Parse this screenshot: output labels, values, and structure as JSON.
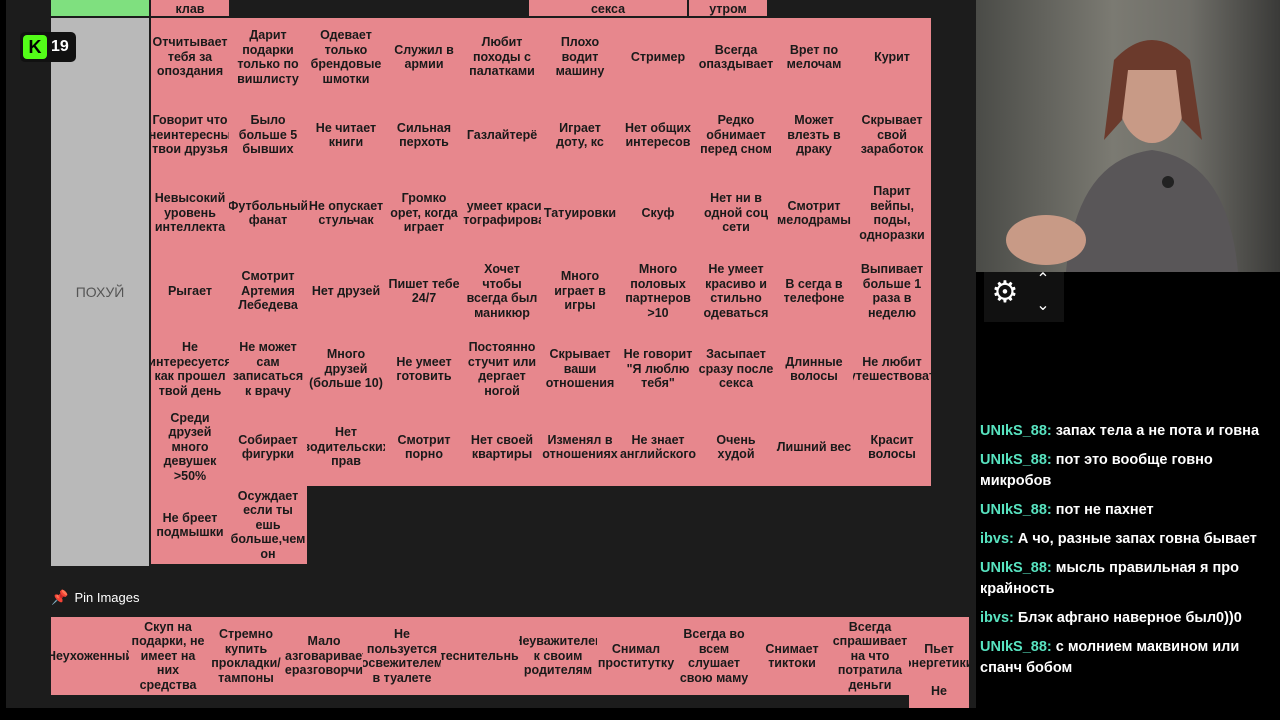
{
  "badge": {
    "count": "19"
  },
  "tier": {
    "top_row_partial": [
      "клав",
      "секса",
      "утром"
    ],
    "label": "ПОХУЙ",
    "rows": [
      [
        "Отчитывает тебя за опоздания",
        "Дарит подарки только по вишлисту",
        "Одевает только брендовые шмотки",
        "Служил в армии",
        "Любит походы с палатками",
        "Плохо водит машину",
        "Стример",
        "Всегда опаздывает",
        "Врет по мелочам",
        "Курит"
      ],
      [
        "Говорит что неинтересны твои друзья",
        "Было больше 5 бывших",
        "Не читает книги",
        "Сильная перхоть",
        "Газлайтерё",
        "Играет доту, кс",
        "Нет общих интересов",
        "Редко обнимает перед сном",
        "Может влезть в драку",
        "Скрывает свой заработок"
      ],
      [
        "Невысокий уровень интеллекта",
        "Футбольный фанат",
        "Не опускает стульчак",
        "Громко орет, когда играет",
        "Не умеет красиво фотографировать",
        "Татуировки",
        "Скуф",
        "Нет ни в одной соц сети",
        "Смотрит мелодрамы",
        "Парит вейпы, поды, одноразки"
      ],
      [
        "Рыгает",
        "Смотрит Артемия Лебедева",
        "Нет друзей",
        "Пишет тебе 24/7",
        "Хочет чтобы всегда был маникюр",
        "Много играет в игры",
        "Много половых партнеров >10",
        "Не умеет красиво и стильно одеваться",
        "В сегда в телефоне",
        "Выпивает больше 1 раза в неделю"
      ],
      [
        "Не интересуется как прошел твой день",
        "Не может сам записаться к врачу",
        "Много друзей (больше 10)",
        "Не умеет готовить",
        "Постоянно стучит или дергает ногой",
        "Скрывает ваши отношения",
        "Не говорит \"Я люблю тебя\"",
        "Засыпает сразу после секса",
        "Длинные волосы",
        "Не любит путешествовать"
      ],
      [
        "Среди друзей много девушек >50%",
        "Собирает фигурки",
        "Нет водительских прав",
        "Смотрит порно",
        "Нет своей квартиры",
        "Изменял в отношениях",
        "Не знает английского",
        "Очень худой",
        "Лишний вес",
        "Красит волосы"
      ],
      [
        "Не бреет подмышки",
        "Осуждает если ты ешь больше,чем он"
      ]
    ]
  },
  "pin": {
    "title": "Pin Images",
    "items": [
      "Неухоженный",
      "Скуп на подарки, не имеет на них средства",
      "Стремно купить прокладки/тампоны",
      "Мало разговаривает, неразговорчив",
      "Не пользуется освежителем в туалете",
      "Стеснительный",
      "Неуважителен к своим родителям",
      "Снимал проститутку",
      "Всегда во всем слушает свою маму",
      "Снимает тиктоки",
      "Всегда спрашивает на что потратила деньги",
      "Пьет энергетики"
    ],
    "extra": "Не"
  },
  "chat": [
    {
      "user": "UNIkS_88:",
      "text": "запах тела а не пота и говна"
    },
    {
      "user": "UNIkS_88:",
      "text": "пот это вообще говно микробов"
    },
    {
      "user": "UNIkS_88:",
      "text": "пот не пахнет"
    },
    {
      "user": "ibvs:",
      "text": "А чо, разные запах говна бывает"
    },
    {
      "user": "UNIkS_88:",
      "text": "мысль правильная я про крайность"
    },
    {
      "user": "ibvs:",
      "text": "Блэк афгано наверное был0))0"
    },
    {
      "user": "UNIkS_88:",
      "text": "с молнием маквином или спанч бобом"
    }
  ],
  "colors": {
    "cell": "#e7878d",
    "label_grey": "#b9b9b9",
    "label_green": "#7fe07f",
    "chat_user": "#58e3c0",
    "kick": "#53fc18"
  },
  "icons": {
    "badge": "kick-logo-icon",
    "pin": "pin-icon",
    "settings": "gear-icon",
    "up": "chevron-up-icon",
    "down": "chevron-down-icon"
  }
}
